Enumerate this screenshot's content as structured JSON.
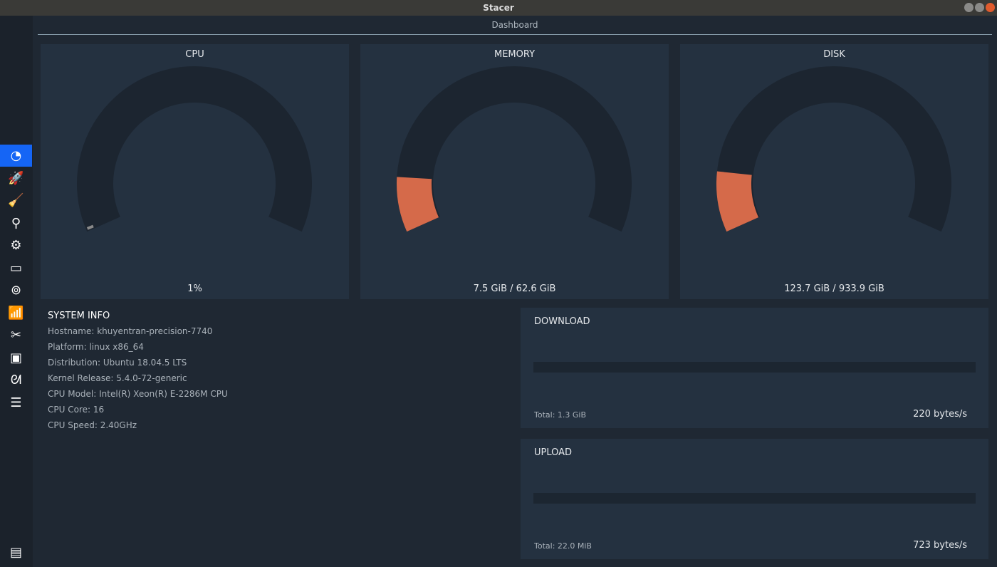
{
  "window": {
    "title": "Stacer"
  },
  "header": {
    "title": "Dashboard"
  },
  "sidebar": {
    "items": [
      {
        "name": "dashboard",
        "icon": "speedometer-icon",
        "glyph": "◔",
        "active": true
      },
      {
        "name": "startup-apps",
        "icon": "rocket-icon",
        "glyph": "🚀"
      },
      {
        "name": "system-cleaner",
        "icon": "broom-icon",
        "glyph": "🧹"
      },
      {
        "name": "search",
        "icon": "search-icon",
        "glyph": "⚲"
      },
      {
        "name": "services",
        "icon": "gears-icon",
        "glyph": "⚙"
      },
      {
        "name": "processes",
        "icon": "processes-icon",
        "glyph": "▭"
      },
      {
        "name": "uninstaller",
        "icon": "uninstaller-icon",
        "glyph": "⊚"
      },
      {
        "name": "resources",
        "icon": "chart-icon",
        "glyph": "📶"
      },
      {
        "name": "helpers",
        "icon": "tools-icon",
        "glyph": "✂"
      },
      {
        "name": "apt-repository",
        "icon": "package-icon",
        "glyph": "▣"
      },
      {
        "name": "gnome-settings",
        "icon": "gnome-foot-icon",
        "glyph": "ᘛ"
      },
      {
        "name": "settings",
        "icon": "sliders-icon",
        "glyph": "☰"
      }
    ],
    "feedback_glyph": "▤"
  },
  "gauges": [
    {
      "title": "CPU",
      "value": "1%",
      "fraction": 0.01,
      "fill": "#8a8a8a"
    },
    {
      "title": "MEMORY",
      "value": "7.5 GiB / 62.6 GiB",
      "fraction": 0.12,
      "fill": "#d56a4a"
    },
    {
      "title": "DISK",
      "value": "123.7 GiB / 933.9 GiB",
      "fraction": 0.132,
      "fill": "#d56a4a"
    }
  ],
  "system_info": {
    "title": "SYSTEM INFO",
    "lines": [
      "Hostname: khuyentran-precision-7740",
      "Platform: linux x86_64",
      "Distribution: Ubuntu 18.04.5 LTS",
      "Kernel Release: 5.4.0-72-generic",
      "CPU Model: Intel(R) Xeon(R) E-2286M CPU",
      "CPU Core: 16",
      "CPU Speed: 2.40GHz"
    ]
  },
  "download": {
    "title": "DOWNLOAD",
    "total": "Total: 1.3 GiB",
    "rate": "220 bytes/s"
  },
  "upload": {
    "title": "UPLOAD",
    "total": "Total: 22.0 MiB",
    "rate": "723 bytes/s"
  }
}
